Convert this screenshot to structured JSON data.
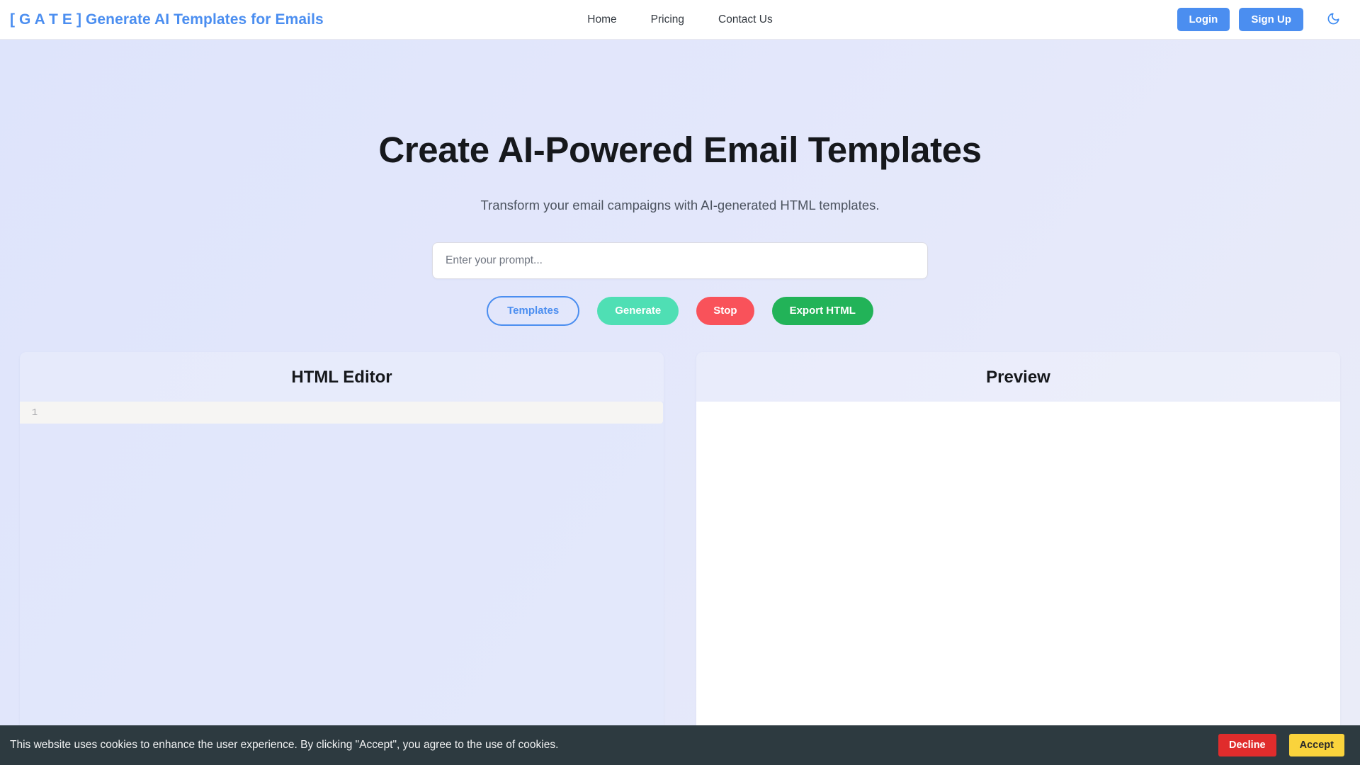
{
  "navbar": {
    "brand_bracket_open": "[ G A T E ]",
    "brand_rest": " Generate AI Templates for Emails",
    "brand_full": "[ G A T E ] Generate AI Templates for Emails",
    "links": [
      {
        "label": "Home"
      },
      {
        "label": "Pricing"
      },
      {
        "label": "Contact Us"
      }
    ],
    "login_label": "Login",
    "signup_label": "Sign Up",
    "theme_toggle_icon": "moon-icon",
    "accent_color": "#4b8ef0"
  },
  "hero": {
    "title": "Create AI-Powered Email Templates",
    "subtitle": "Transform your email campaigns with AI-generated HTML templates.",
    "prompt_placeholder": "Enter your prompt...",
    "prompt_value": ""
  },
  "actions": {
    "templates_label": "Templates",
    "generate_label": "Generate",
    "stop_label": "Stop",
    "export_label": "Export HTML",
    "colors": {
      "templates_border": "#4b8ef0",
      "generate_bg": "#4fdfb4",
      "stop_bg": "#f9525a",
      "export_bg": "#22b358"
    }
  },
  "editor": {
    "title": "HTML Editor",
    "line_number": "1",
    "content": ""
  },
  "preview": {
    "title": "Preview",
    "content": ""
  },
  "cookie": {
    "message": "This website uses cookies to enhance the user experience. By clicking \"Accept\", you agree to the use of cookies.",
    "decline_label": "Decline",
    "accept_label": "Accept",
    "decline_color": "#e02c2c",
    "accept_color": "#fad33c"
  }
}
